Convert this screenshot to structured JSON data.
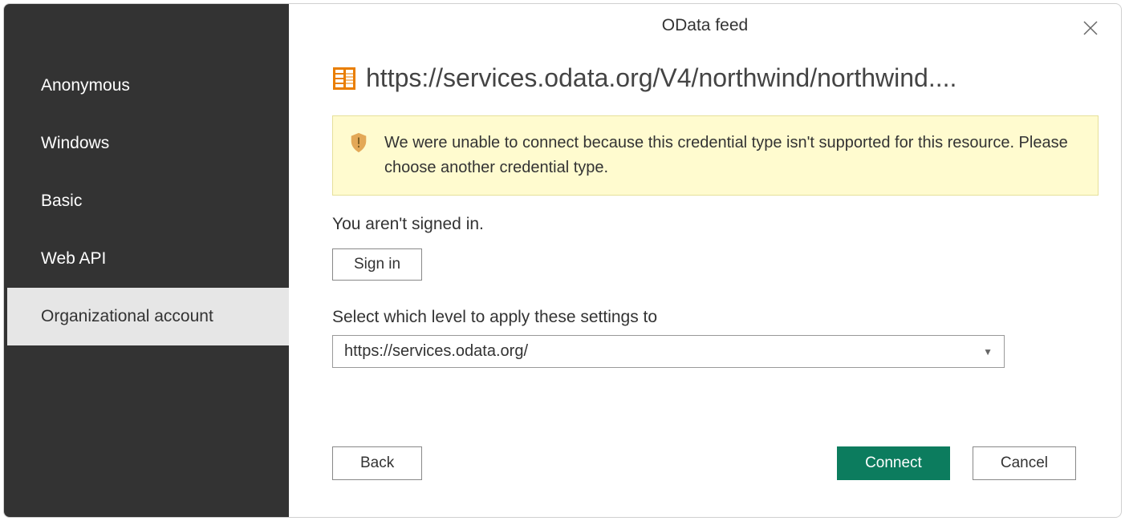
{
  "dialog": {
    "title": "OData feed"
  },
  "sidebar": {
    "items": [
      {
        "label": "Anonymous",
        "selected": false
      },
      {
        "label": "Windows",
        "selected": false
      },
      {
        "label": "Basic",
        "selected": false
      },
      {
        "label": "Web API",
        "selected": false
      },
      {
        "label": "Organizational account",
        "selected": true
      }
    ]
  },
  "main": {
    "url": "https://services.odata.org/V4/northwind/northwind....",
    "warning": "We were unable to connect because this credential type isn't supported for this resource. Please choose another credential type.",
    "signed_in_text": "You aren't signed in.",
    "signin_label": "Sign in",
    "level_label": "Select which level to apply these settings to",
    "level_value": "https://services.odata.org/"
  },
  "footer": {
    "back": "Back",
    "connect": "Connect",
    "cancel": "Cancel"
  }
}
